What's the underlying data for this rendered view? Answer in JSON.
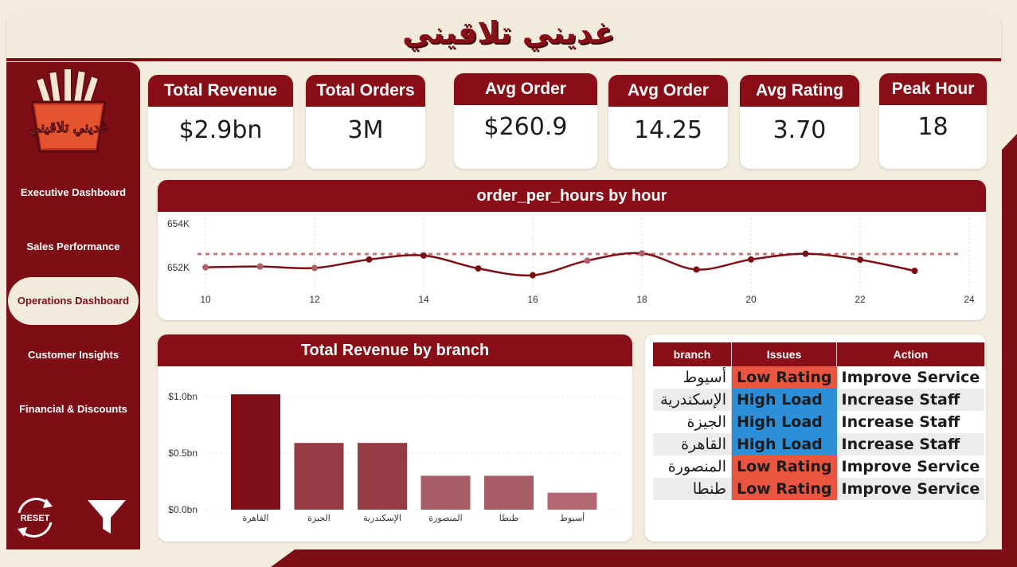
{
  "title": "غديني تلاقيني",
  "logo_text": "غديني تلاقيني",
  "nav": [
    {
      "label": "Executive Dashboard"
    },
    {
      "label": "Sales Performance"
    },
    {
      "label": "Operations Dashboard",
      "active": true
    },
    {
      "label": "Customer Insights"
    },
    {
      "label": "Financial & Discounts"
    }
  ],
  "reset_label": "RESET",
  "kpis": [
    {
      "label": "Total Revenue",
      "value": "$2.9bn"
    },
    {
      "label": "Total Orders",
      "value": "3M"
    },
    {
      "label": "Avg Order",
      "value": "$260.9"
    },
    {
      "label": "Avg Order",
      "value": "14.25"
    },
    {
      "label": "Avg Rating",
      "value": "3.70"
    },
    {
      "label": "Peak Hour",
      "value": "18"
    }
  ],
  "colors": {
    "brand": "#8a0e17",
    "cream": "#f3eddf",
    "low_rating": "#e9553f",
    "high_load": "#2d8fd8"
  },
  "issues_table": {
    "headers": [
      "branch",
      "Issues",
      "Action"
    ],
    "rows": [
      {
        "branch": "أسيوط",
        "issue": "Low Rating",
        "action": "Improve Service"
      },
      {
        "branch": "الإسكندرية",
        "issue": "High Load",
        "action": "Increase Staff"
      },
      {
        "branch": "الجيزة",
        "issue": "High Load",
        "action": "Increase Staff"
      },
      {
        "branch": "القاهرة",
        "issue": "High Load",
        "action": "Increase Staff"
      },
      {
        "branch": "المنصورة",
        "issue": "Low Rating",
        "action": "Improve Service"
      },
      {
        "branch": "طنطا",
        "issue": "Low Rating",
        "action": "Improve Service"
      }
    ]
  },
  "chart_data": [
    {
      "type": "line",
      "title": "order_per_hours by hour",
      "x": [
        10,
        11,
        12,
        13,
        14,
        15,
        16,
        17,
        18,
        19,
        20,
        21,
        22,
        23
      ],
      "series": [
        {
          "values": [
            652010,
            652050,
            651980,
            652370,
            652550,
            651960,
            651650,
            652320,
            652650,
            651910,
            652370,
            652630,
            652360,
            651850
          ]
        }
      ],
      "reference_line": 652620,
      "xlim": [
        10,
        24
      ],
      "xticks": [
        "10",
        "12",
        "14",
        "16",
        "18",
        "20",
        "22",
        "24"
      ],
      "ylim": [
        651000,
        654000
      ],
      "yticks": [
        {
          "value": 652000,
          "label": "652K"
        },
        {
          "value": 654000,
          "label": "654K"
        }
      ],
      "grid": "vertical dotted"
    },
    {
      "type": "bar",
      "title": "Total Revenue by branch",
      "categories": [
        "القاهرة",
        "الجيزة",
        "الإسكندرية",
        "المنصورة",
        "طنطا",
        "أسيوط"
      ],
      "values": [
        1.02,
        0.59,
        0.59,
        0.3,
        0.3,
        0.15
      ],
      "ylim": [
        0,
        1.1
      ],
      "yticks": [
        {
          "value": 0,
          "label": "$0.0bn"
        },
        {
          "value": 0.5,
          "label": "$0.5bn"
        },
        {
          "value": 1.0,
          "label": "$1.0bn"
        }
      ],
      "colors": [
        "#800e18",
        "#963a44",
        "#963a44",
        "#a65e64",
        "#a65e64",
        "#b3696f"
      ]
    }
  ]
}
